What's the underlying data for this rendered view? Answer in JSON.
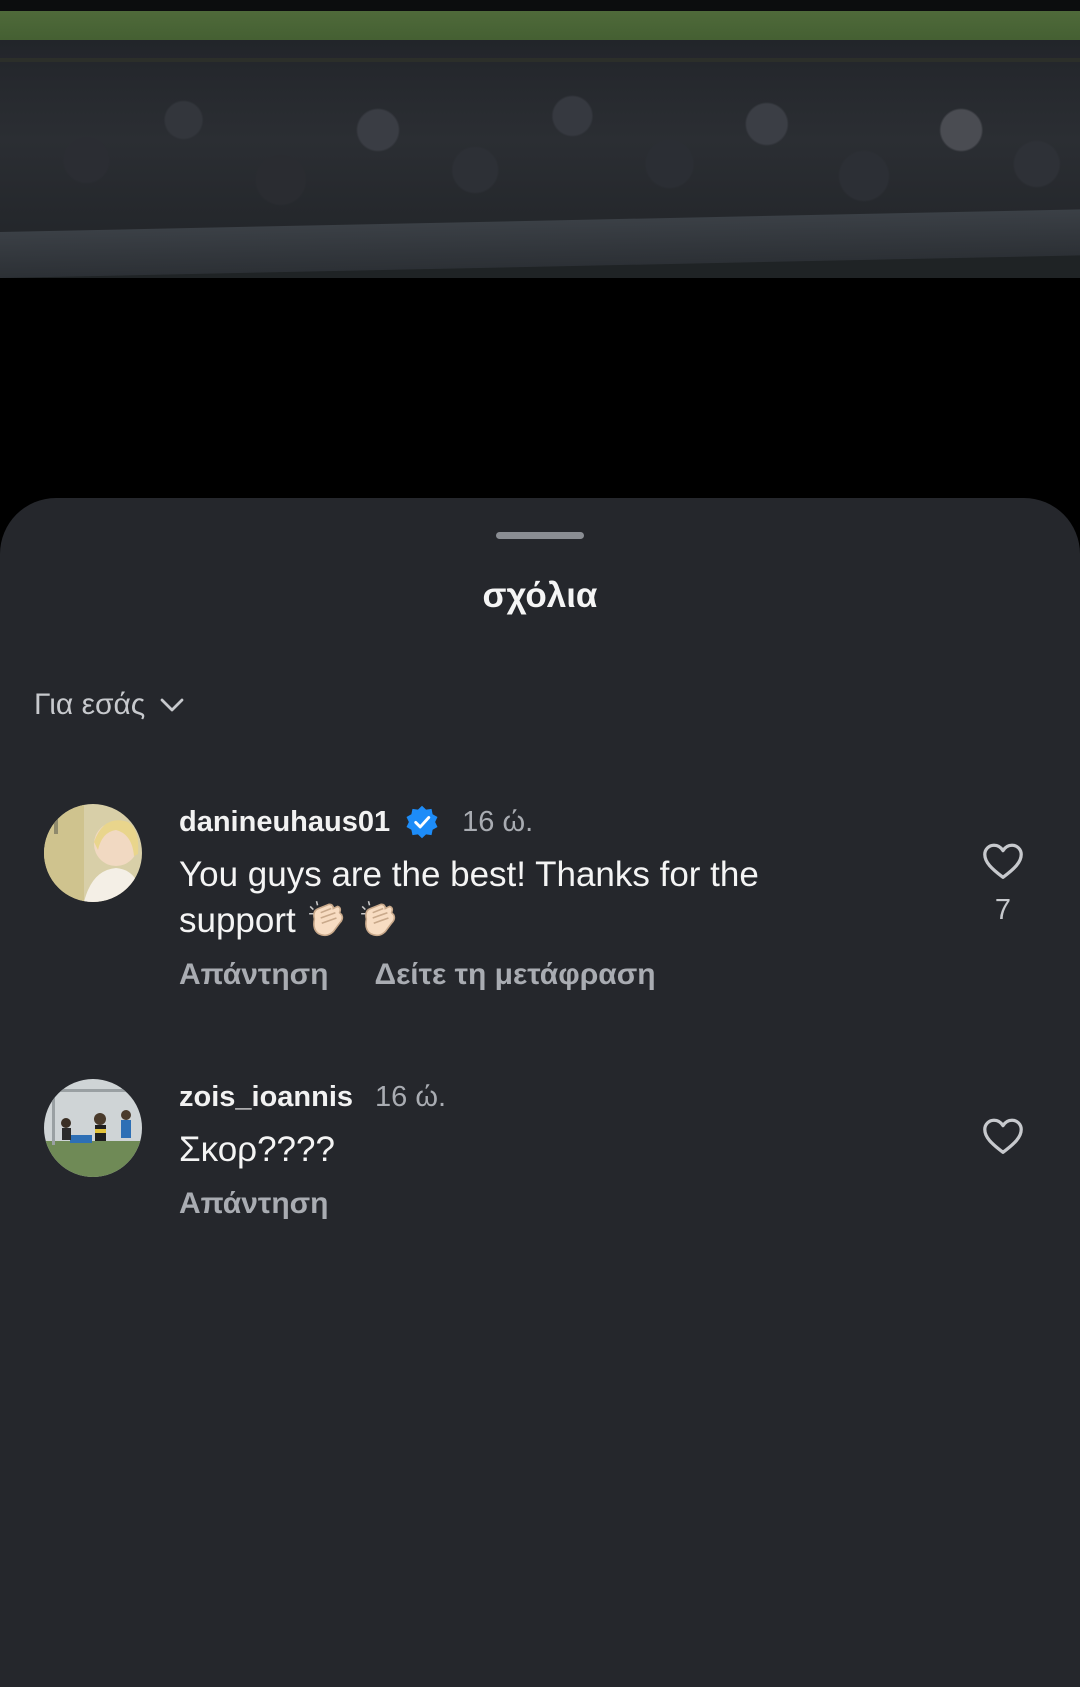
{
  "sheet": {
    "title": "σχόλια",
    "sort_label": "Για εσάς",
    "sort_icon": "chevron-down-icon"
  },
  "comments": [
    {
      "username": "danineuhaus01",
      "verified": true,
      "time": "16 ώ.",
      "text": "You guys are the best! Thanks for the support",
      "text_line1": "You guys are the best! Thanks for the",
      "text_line2": "support",
      "emoji": [
        "clapping-hands-icon",
        "clapping-hands-icon"
      ],
      "reply_label": "Απάντηση",
      "translate_label": "Δείτε τη μετάφραση",
      "likes": "7"
    },
    {
      "username": "zois_ioannis",
      "verified": false,
      "time": "16 ώ.",
      "text": "Σκορ????",
      "reply_label": "Απάντηση"
    }
  ],
  "colors": {
    "sheet_background": "#25272c",
    "verified_badge": "#1d8cf8",
    "secondary_text": "#a9acb2"
  }
}
